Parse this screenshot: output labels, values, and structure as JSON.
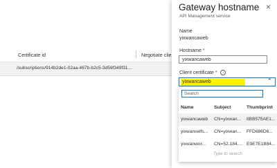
{
  "background_grid": {
    "columns": {
      "certificate_id": "Certificate id",
      "negotiate": "Negotiate clie"
    },
    "rows": [
      {
        "certificate_id": "/subscriptions/914b2de1-02aa-467b-b2c5-3d59f349f31..."
      }
    ]
  },
  "panel": {
    "title": "Gateway hostname",
    "subtitle": "API Management service",
    "close_glyph": "×",
    "name": {
      "label": "Name",
      "value": "yixwancaweb"
    },
    "hostname": {
      "label": "Hostname",
      "required": "*",
      "value": "yixwancaweb"
    },
    "client_certificate": {
      "label": "Client certificate",
      "required": "*",
      "info_icon": "i",
      "selected": "yixwancaweb",
      "chevron": "⌃"
    },
    "dropdown": {
      "search_placeholder": "Search",
      "headers": {
        "name": "Name",
        "subject": "Subject",
        "thumbprint": "Thumbprint"
      },
      "rows": [
        {
          "name": "yixwancaweb",
          "subject": "CN=yixwan...",
          "thumbprint": "8BB575AE1...",
          "selected": true
        },
        {
          "name": "yixwanselfs...",
          "subject": "CN=yixwan...",
          "thumbprint": "FFD686D6..."
        },
        {
          "name": "yixwanwor...",
          "subject": "CN=52.184....",
          "thumbprint": "E9E7E1B84..."
        }
      ],
      "hint": "Type to search"
    }
  },
  "colors": {
    "accent": "#0078d4",
    "highlight": "#fff100",
    "required": "#a4262c"
  }
}
